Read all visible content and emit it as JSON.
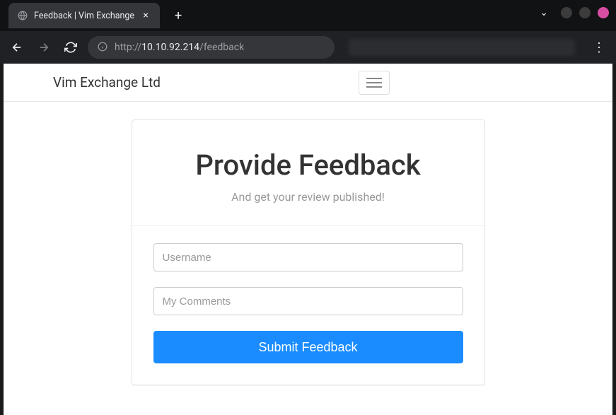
{
  "browser": {
    "tab_title": "Feedback | Vim Exchange",
    "url_prefix": "http://",
    "url_host": "10.10.92.214",
    "url_path": "/feedback"
  },
  "navbar": {
    "brand": "Vim Exchange Ltd"
  },
  "panel": {
    "heading": "Provide Feedback",
    "subheading": "And get your review published!"
  },
  "form": {
    "username_placeholder": "Username",
    "comments_placeholder": "My Comments",
    "submit_label": "Submit Feedback"
  }
}
